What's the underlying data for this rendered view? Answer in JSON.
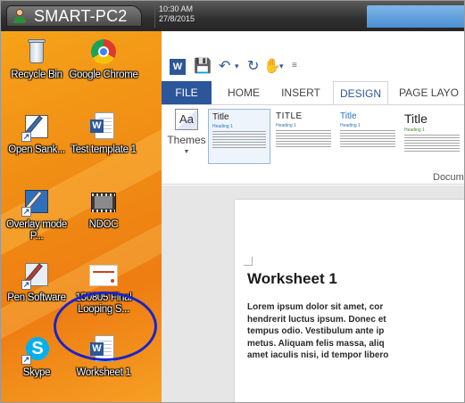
{
  "taskbar": {
    "machine_name": "SMART-PC2",
    "time": "10:30 AM",
    "date": "27/8/2015"
  },
  "desktop": {
    "icons": [
      {
        "label": "Recycle Bin",
        "icon": "recycle-bin-icon"
      },
      {
        "label": "Google Chrome",
        "icon": "chrome-icon"
      },
      {
        "label": "Open Sank...",
        "icon": "shortcut-tool-icon"
      },
      {
        "label": "Test template 1",
        "icon": "word-document-icon"
      },
      {
        "label": "Overlay mode P...",
        "icon": "shortcut-tool-icon"
      },
      {
        "label": "NDOC",
        "icon": "film-icon"
      },
      {
        "label": "Pen Software",
        "icon": "pen-tool-icon"
      },
      {
        "label": "150805 Final Looping S...",
        "icon": "presentation-icon"
      },
      {
        "label": "Skype",
        "icon": "skype-icon"
      },
      {
        "label": "Worksheet 1",
        "icon": "word-document-icon"
      }
    ],
    "highlight_color": "#1a24c8"
  },
  "word": {
    "tabs": [
      "FILE",
      "HOME",
      "INSERT",
      "DESIGN",
      "PAGE LAYO"
    ],
    "active_tab": "DESIGN",
    "themes_label": "Themes",
    "style_gallery": [
      {
        "title": "Title",
        "heading": "Heading 1"
      },
      {
        "title": "TITLE",
        "heading": "Heading 1"
      },
      {
        "title": "Title",
        "heading": "Heading 1"
      },
      {
        "title": "Title",
        "heading": "Heading 1"
      }
    ],
    "group_label": "Docum",
    "document": {
      "title": "Worksheet 1",
      "body_lines": [
        "Lorem ipsum dolor sit amet, cor",
        "hendrerit luctus ipsum. Donec et",
        "tempus odio. Vestibulum ante ip",
        "metus. Aliquam felis massa, aliq",
        "amet iaculis nisi, id tempor libero"
      ]
    },
    "accent_color": "#2b579a"
  }
}
